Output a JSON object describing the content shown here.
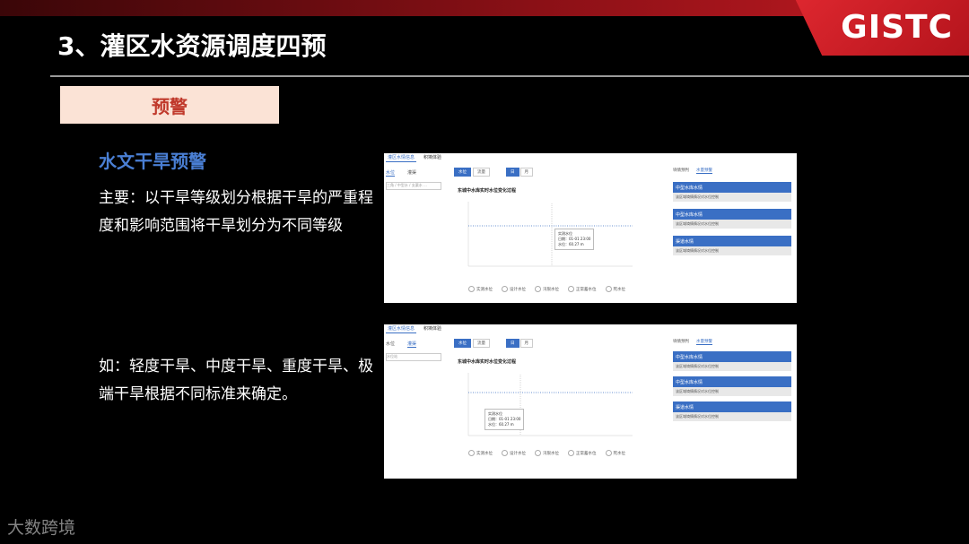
{
  "slide": {
    "title": "3、灌区水资源调度四预",
    "logo": "GISTC",
    "badge": "预警",
    "subhead": "水文干旱预警",
    "paragraph1": "主要：以干旱等级划分根据干旱的严重程度和影响范围将干旱划分为不同等级",
    "paragraph2": "如：轻度干旱、中度干旱、重度干旱、极端干旱根据不同标准来确定。",
    "watermark": "大数跨境"
  },
  "screenshot1": {
    "tabs": [
      "灌区水情信息",
      "积墒体验"
    ],
    "left_nav": [
      "水位",
      "灌渠"
    ],
    "dropdown": "三角 / 中型水 / 支渠水 ...",
    "buttons": [
      "水位",
      "流量",
      "日",
      "月"
    ],
    "chart_title": "东城中水库实时水位变化过程",
    "y_axis_label": "水位(m)",
    "right_tabs": [
      "墒情预判",
      "水量预警"
    ],
    "cards": [
      {
        "title": "中型水库水情",
        "body": "该区域墒情情况对水位控制"
      },
      {
        "title": "中型水库水情",
        "body": "该区域墒情情况对水位控制"
      },
      {
        "title": "渠道水情",
        "body": "该区域墒情情况对水位控制"
      }
    ],
    "legend": [
      "实测水位",
      "设计水位",
      "汛限水位",
      "正常蓄水位",
      "死水位"
    ],
    "tooltip": [
      "实测水位",
      "日期：01-01 23:00",
      "水位：60.27 m"
    ]
  },
  "screenshot2": {
    "tabs": [
      "灌区水情信息",
      "积墒体验"
    ],
    "left_nav": [
      "水位",
      "灌渠"
    ],
    "dropdown": "水位站",
    "buttons": [
      "水位",
      "流量",
      "日",
      "月"
    ],
    "chart_title": "东城中水库实时水位变化过程",
    "y_axis_label": "水位(m)",
    "right_tabs": [
      "墒情预判",
      "水量预警"
    ],
    "cards": [
      {
        "title": "中型水库水情",
        "body": "该区域墒情情况对水位控制"
      },
      {
        "title": "中型水库水情",
        "body": "该区域墒情情况对水位控制"
      },
      {
        "title": "渠道水情",
        "body": "该区域墒情情况对水位控制"
      }
    ],
    "legend": [
      "实测水位",
      "设计水位",
      "汛限水位",
      "正常蓄水位",
      "死水位"
    ],
    "tooltip": [
      "实测水位",
      "日期：01-01 23:00",
      "水位：60.27 m"
    ]
  },
  "colors": {
    "accent_blue": "#3a6fc4",
    "badge_bg": "#fbe3d6",
    "badge_text": "#c0392b",
    "subhead": "#4a7fd4",
    "brand_red": "#c21a22"
  }
}
